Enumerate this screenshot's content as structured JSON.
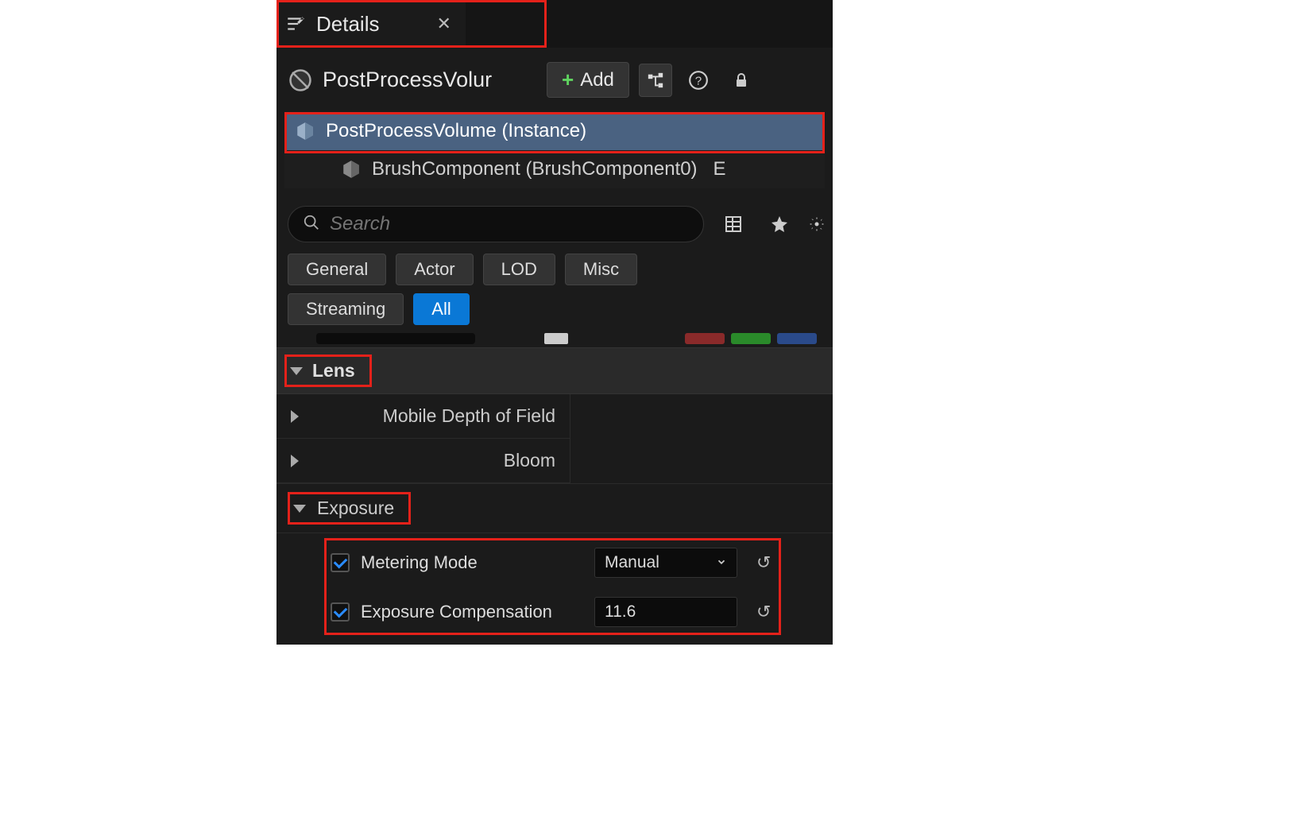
{
  "tab": {
    "title": "Details"
  },
  "actor": {
    "name": "PostProcessVolur",
    "add_label": "Add"
  },
  "tree": {
    "instance": "PostProcessVolume (Instance)",
    "brush": "BrushComponent (BrushComponent0)",
    "brush_suffix": "E"
  },
  "search": {
    "placeholder": "Search"
  },
  "filters": {
    "general": "General",
    "actor": "Actor",
    "lod": "LOD",
    "misc": "Misc",
    "streaming": "Streaming",
    "all": "All"
  },
  "categories": {
    "lens": "Lens",
    "mobile_dof": "Mobile Depth of Field",
    "bloom": "Bloom",
    "exposure": "Exposure"
  },
  "exposure": {
    "metering_label": "Metering Mode",
    "metering_value": "Manual",
    "compensation_label": "Exposure Compensation",
    "compensation_value": "11.6"
  }
}
